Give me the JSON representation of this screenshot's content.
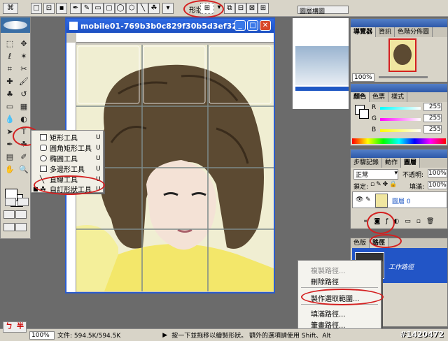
{
  "options_bar": {
    "shape_label": "形狀:"
  },
  "doc_window": {
    "title": "mobile01-769b3b0c829f30b5d3ef32..."
  },
  "flyout": {
    "items": [
      {
        "label": "矩形工具",
        "key": "U",
        "selected": false
      },
      {
        "label": "圓角矩形工具",
        "key": "U",
        "selected": false
      },
      {
        "label": "橢圓工具",
        "key": "U",
        "selected": false
      },
      {
        "label": "多邊形工具",
        "key": "U",
        "selected": false
      },
      {
        "label": "直線工具",
        "key": "U",
        "selected": false
      },
      {
        "label": "自訂形狀工具",
        "key": "U",
        "selected": true
      }
    ]
  },
  "doc_strip_title": "圖層構圖",
  "navigator": {
    "tabs": [
      "導覽器",
      "資訊",
      "色階分佈圖"
    ],
    "zoom": "100%"
  },
  "color_panel": {
    "tabs": [
      "顏色",
      "色票",
      "樣式"
    ],
    "channels": [
      {
        "name": "R",
        "value": "255"
      },
      {
        "name": "G",
        "value": "255"
      },
      {
        "name": "B",
        "value": "255"
      }
    ]
  },
  "layers_panel": {
    "tabs": [
      "步驟記錄",
      "動作",
      "圖層"
    ],
    "blend_mode": "正常",
    "opacity_label": "不透明:",
    "opacity": "100%",
    "lock_label": "鎖定:",
    "fill_label": "填滿:",
    "fill": "100%",
    "layer_name": "圖層 0"
  },
  "paths_panel": {
    "tabs": [
      "色版",
      "路徑"
    ],
    "path_name": "工作路徑"
  },
  "context_menu": {
    "items": [
      "複製路徑...",
      "刪除路徑",
      "製作選取範圍...",
      "填滿路徑...",
      "筆畫路徑..."
    ]
  },
  "status_bar": {
    "zoom": "100%",
    "doc_info": "文件: 594.5K/594.5K",
    "hint": "按一下並拖移以繪製形狀。 額外的選項請使用 Shift、Alt"
  },
  "ime": {
    "left": "ㄅ",
    "right": "半"
  },
  "watermark": "#1420472",
  "colors": {
    "accent_red": "#d42020",
    "title_blue": "#2f6be4"
  }
}
